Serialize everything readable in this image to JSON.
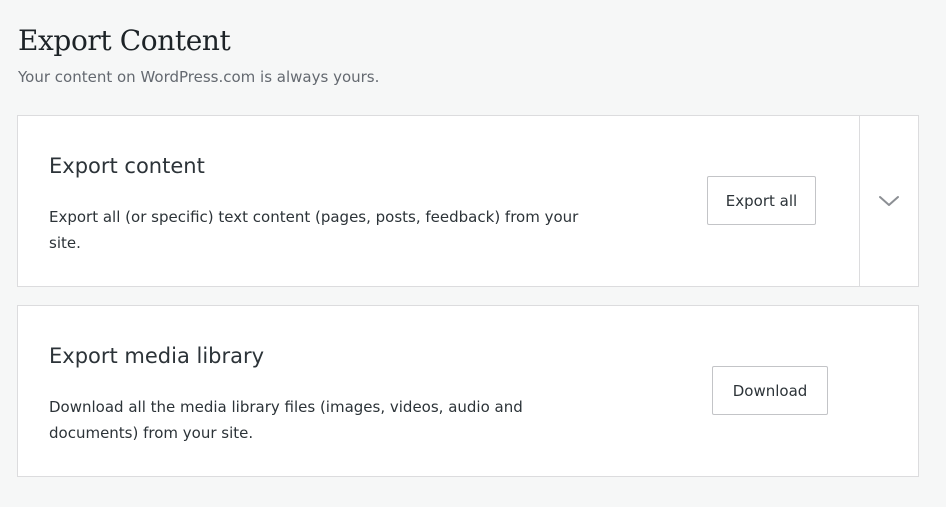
{
  "header": {
    "title": "Export Content",
    "subtitle": "Your content on WordPress.com is always yours."
  },
  "export_content_card": {
    "title": "Export content",
    "description": "Export all (or specific) text content (pages, posts, feedback) from your site.",
    "button_label": "Export all",
    "toggle_icon": "chevron-down-icon"
  },
  "export_media_card": {
    "title": "Export media library",
    "description": "Download all the media library files (images, videos, audio and documents) from your site.",
    "button_label": "Download"
  },
  "colors": {
    "background": "#f6f7f7",
    "card_background": "#ffffff",
    "border": "#dcdcde",
    "text": "#2c3338",
    "muted_text": "#646970",
    "icon": "#8c8f94"
  }
}
